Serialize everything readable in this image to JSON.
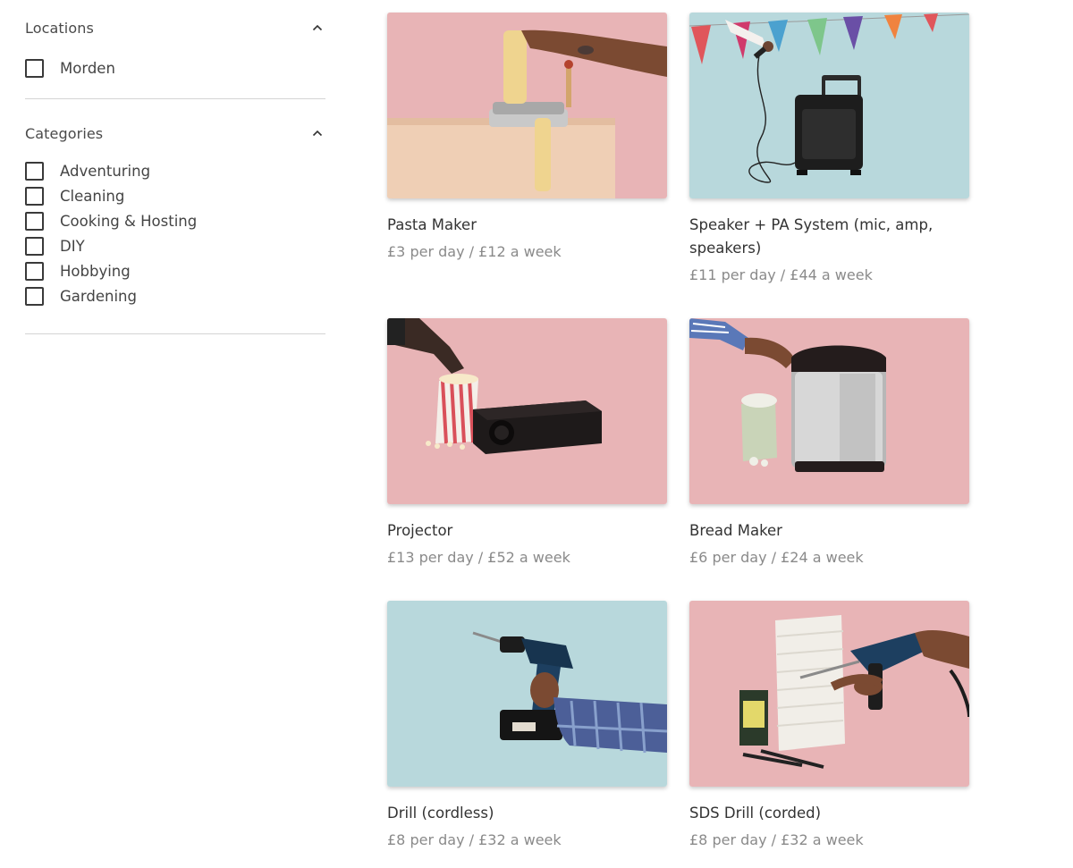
{
  "filters": {
    "locations": {
      "title": "Locations",
      "options": [
        "Morden"
      ]
    },
    "categories": {
      "title": "Categories",
      "options": [
        "Adventuring",
        "Cleaning",
        "Cooking & Hosting",
        "DIY",
        "Hobbying",
        "Gardening"
      ]
    }
  },
  "items": [
    {
      "name": "Pasta Maker",
      "price": "£3 per day / £12 a week",
      "background": "#e8b4b6",
      "image": "pasta-maker-photo"
    },
    {
      "name": "Speaker + PA System (mic, amp, speakers)",
      "price": "£11 per day / £44 a week",
      "background": "#b8d8dc",
      "image": "speaker-pa-photo"
    },
    {
      "name": "Projector",
      "price": "£13 per day / £52 a week",
      "background": "#e8b4b6",
      "image": "projector-photo"
    },
    {
      "name": "Bread Maker",
      "price": "£6 per day / £24 a week",
      "background": "#e8b4b6",
      "image": "bread-maker-photo"
    },
    {
      "name": "Drill (cordless)",
      "price": "£8 per day / £32 a week",
      "background": "#b8d8dc",
      "image": "cordless-drill-photo"
    },
    {
      "name": "SDS Drill (corded)",
      "price": "£8 per day / £32 a week",
      "background": "#e8b4b6",
      "image": "sds-drill-photo"
    }
  ]
}
